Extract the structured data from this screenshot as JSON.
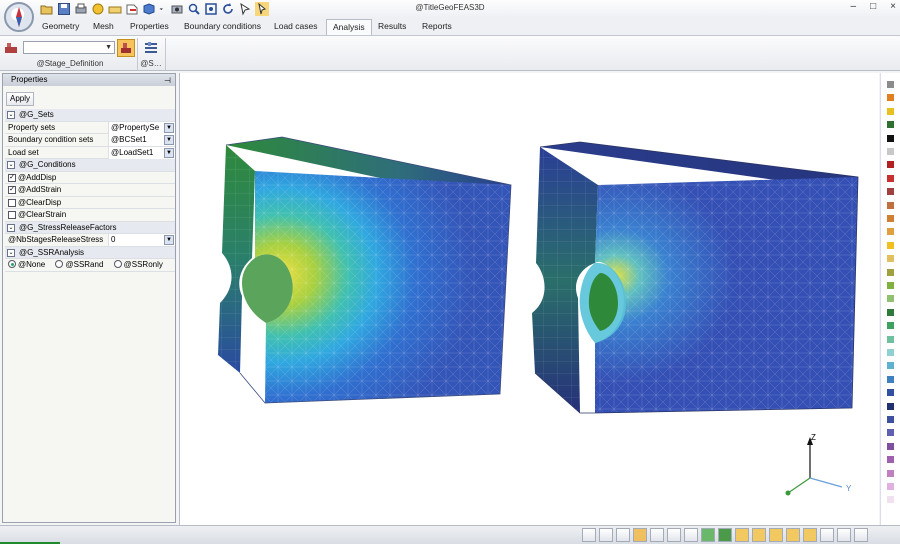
{
  "app": {
    "title": "@TitleGeoFEAS3D",
    "window_controls": [
      "–",
      "□",
      "×"
    ]
  },
  "quick_access": [
    "open-icon",
    "save-icon",
    "print-icon",
    "new-icon",
    "folder-icon",
    "export-icon",
    "cube-icon",
    "dropdown-icon",
    "camera-icon",
    "zoom-icon",
    "zoom-fit-icon",
    "rotate-icon",
    "select-icon",
    "pick-icon"
  ],
  "ribbon_tabs": [
    {
      "label": "Geometry",
      "active": false
    },
    {
      "label": "Mesh",
      "active": false
    },
    {
      "label": "Properties",
      "active": false
    },
    {
      "label": "Boundary conditions",
      "active": false
    },
    {
      "label": "Load cases",
      "active": false
    },
    {
      "label": "Analysis",
      "active": true
    },
    {
      "label": "Results",
      "active": false
    },
    {
      "label": "Reports",
      "active": false
    }
  ],
  "ribbon": {
    "stage_group_label": "@Stage_Definition",
    "second_group_label": "@S…",
    "stage_select_value": ""
  },
  "panel": {
    "title": "Properties",
    "apply_label": "Apply",
    "sections": {
      "sets": "@G_Sets",
      "conditions": "@G_Conditions",
      "stress": "@G_StressReleaseFactors",
      "ssr": "@G_SSRAnalysis"
    },
    "sets_rows": [
      {
        "label": "Property sets",
        "value": "@PropertySe"
      },
      {
        "label": "Boundary condition sets",
        "value": "@BCSet1"
      },
      {
        "label": "Load set",
        "value": "@LoadSet1"
      }
    ],
    "conditions_rows": [
      {
        "label": "@AddDisp",
        "checked": true
      },
      {
        "label": "@AddStrain",
        "checked": true
      },
      {
        "label": "@ClearDisp",
        "checked": false
      },
      {
        "label": "@ClearStrain",
        "checked": false
      }
    ],
    "stress_row": {
      "label": "@NbStagesReleaseStress",
      "value": "0"
    },
    "ssr_options": [
      {
        "label": "@None",
        "selected": true
      },
      {
        "label": "@SSRand",
        "selected": false
      },
      {
        "label": "@SSRonly",
        "selected": false
      }
    ]
  },
  "axes": {
    "z": "Z",
    "y": "Y"
  },
  "palette_colors": [
    "#8c8c8c",
    "#e08020",
    "#e8c020",
    "#2f6f2f",
    "#111111",
    "#c8c8c8",
    "#b02020",
    "#c83030",
    "#a04040",
    "#c07040",
    "#d08030",
    "#e0a040",
    "#f0c020",
    "#e0c060",
    "#a0a040",
    "#80b040",
    "#90c070",
    "#2f7a3a",
    "#40a060",
    "#70c0a0",
    "#90d0d0",
    "#60b0d0",
    "#4080c0",
    "#3050a0",
    "#203070",
    "#4050a0",
    "#6060b0",
    "#8050a0",
    "#a060b0",
    "#c080c0",
    "#e0b0e0",
    "#f0e0f0"
  ]
}
